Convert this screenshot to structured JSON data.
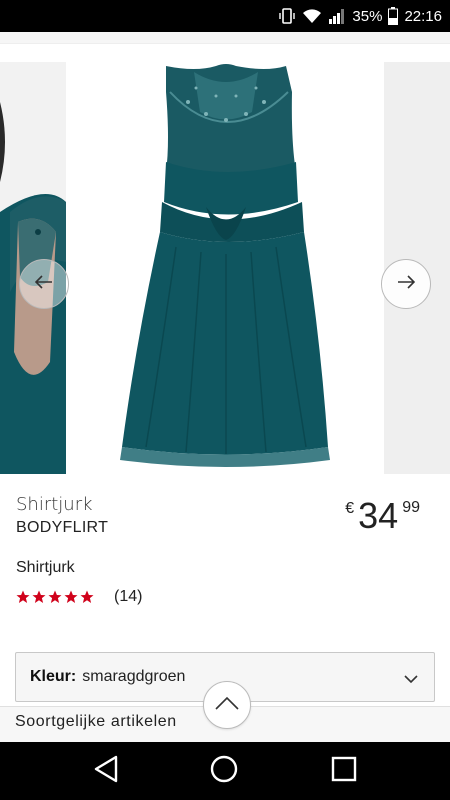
{
  "status_bar": {
    "battery": "35%",
    "time": "22:16",
    "icons": [
      "vibrate-icon",
      "wifi-icon",
      "signal-icon",
      "battery-icon"
    ]
  },
  "carousel": {
    "favorite_icon": "heart-outline-icon",
    "prev_icon": "arrow-left-icon",
    "next_icon": "arrow-right-icon"
  },
  "product": {
    "type": "Shirtjurk",
    "brand": "BODYFLIRT",
    "price_currency": "€",
    "price_main": "34",
    "price_cents": "99",
    "subtitle": "Shirtjurk",
    "rating_stars": 5,
    "rating_count": "(14)"
  },
  "color_select": {
    "label": "Kleur:",
    "value": "smaragdgroen"
  },
  "similar": {
    "title": "Soortgelijke artikelen"
  },
  "colors": {
    "star": "#d0021b",
    "heart": "#d0021b",
    "dress": "#0f5660"
  }
}
